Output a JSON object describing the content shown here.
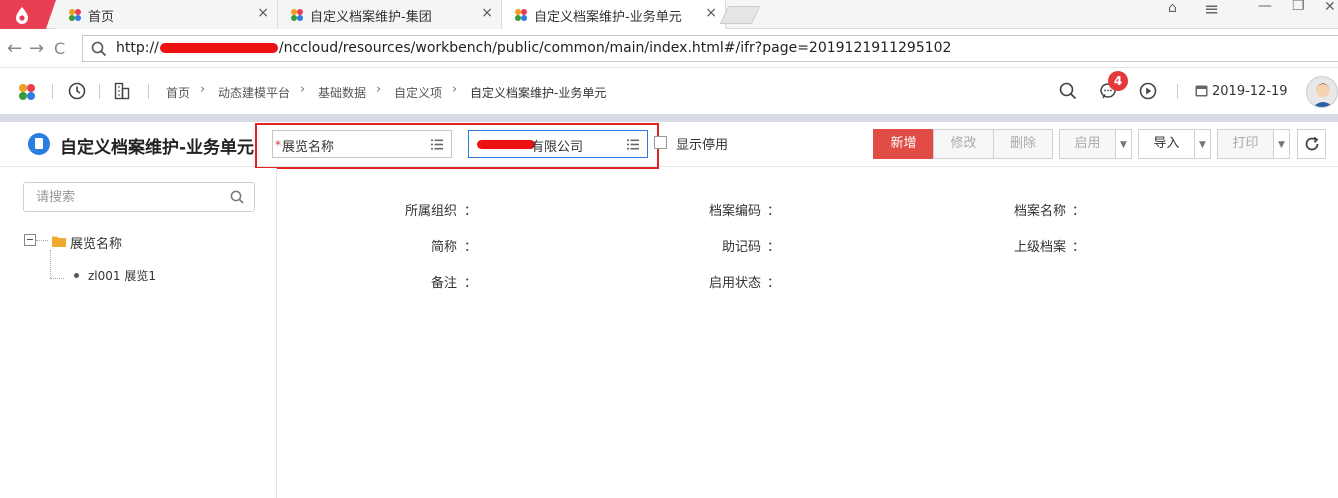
{
  "browser": {
    "tabs": [
      {
        "label": "首页"
      },
      {
        "label": "自定义档案维护-集团"
      },
      {
        "label": "自定义档案维护-业务单元"
      }
    ],
    "tab_close": "×",
    "url_prefix": "http://",
    "url_suffix": "/nccloud/resources/workbench/public/common/main/index.html#/ifr?page=2019121911295102",
    "nav": {
      "back": "←",
      "forward": "→",
      "refresh": "C"
    },
    "window_controls": {
      "minimize": "—",
      "maximize": "❐",
      "close": "✕",
      "menu": "≡",
      "user": "⌂"
    }
  },
  "header": {
    "breadcrumb": [
      "首页",
      "动态建模平台",
      "基础数据",
      "自定义项",
      "自定义档案维护-业务单元"
    ],
    "breadcrumb_separator": "›",
    "message_count": "4",
    "date": "2019-12-19"
  },
  "toolbar": {
    "title": "自定义档案维护-业务单元",
    "ref_field_1": "展览名称",
    "ref_field_2": "有限公司",
    "required_mark": "*",
    "show_disabled": "显示停用",
    "buttons": {
      "add": "新增",
      "edit": "修改",
      "delete": "删除",
      "enable": "启用",
      "import": "导入",
      "print": "打印"
    }
  },
  "sidebar": {
    "search_placeholder": "请搜索",
    "tree": {
      "root_label": "展览名称",
      "children": [
        "zl001 展览1"
      ]
    }
  },
  "form": {
    "fields": [
      {
        "label": "所属组织"
      },
      {
        "label": "档案编码"
      },
      {
        "label": "档案名称"
      },
      {
        "label": "简称"
      },
      {
        "label": "助记码"
      },
      {
        "label": "上级档案"
      },
      {
        "label": "备注"
      },
      {
        "label": "启用状态"
      }
    ],
    "colon": "："
  },
  "colors": {
    "brand_red": "#e83e52",
    "primary_button": "#e14c46",
    "accent_blue": "#2a7de1",
    "highlight_box": "#e22222"
  }
}
